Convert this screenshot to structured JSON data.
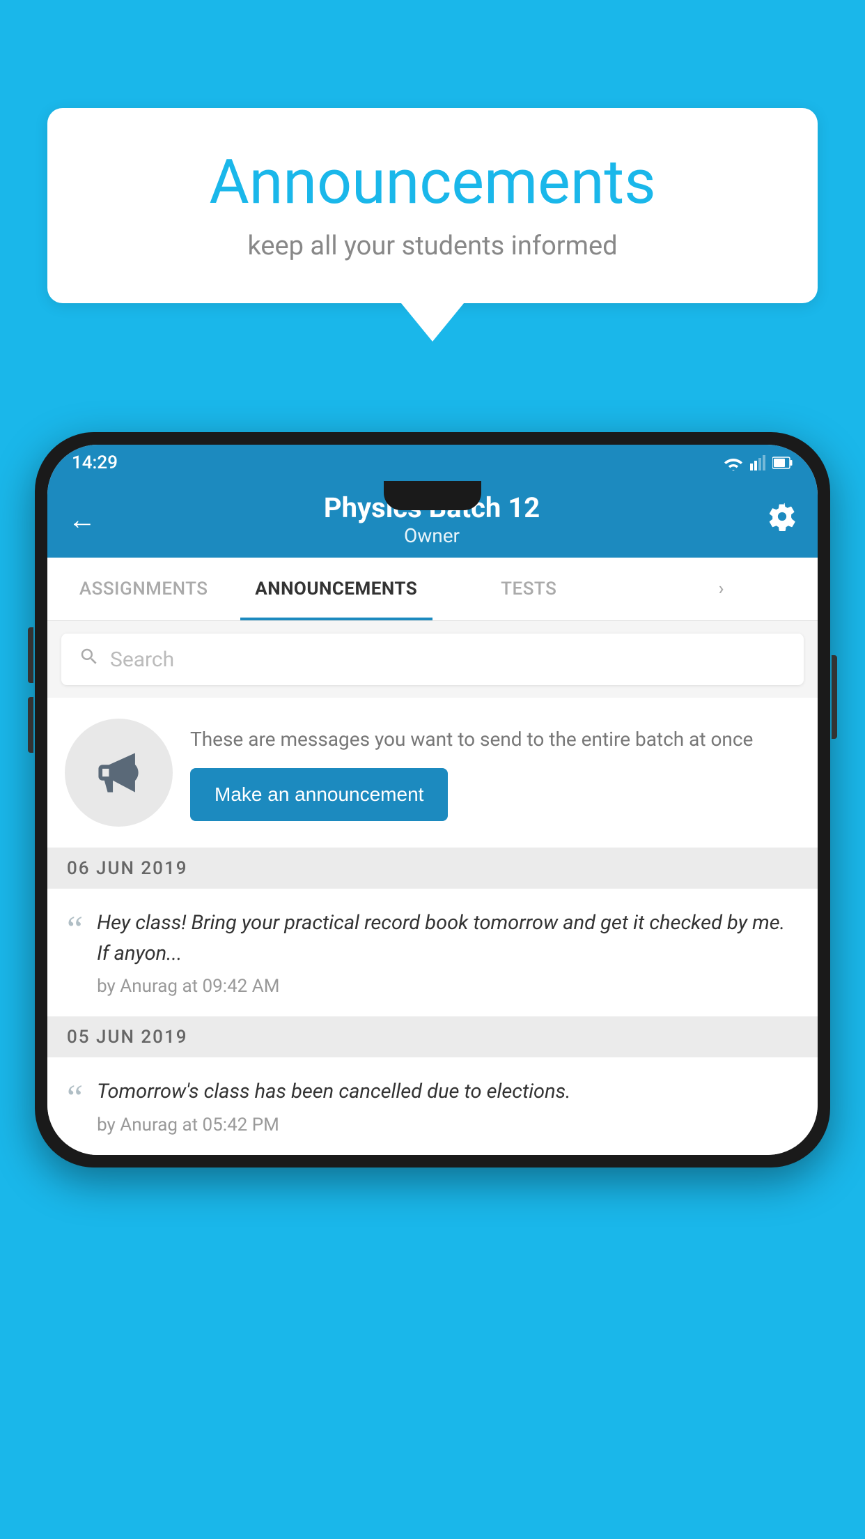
{
  "bubble": {
    "title": "Announcements",
    "subtitle": "keep all your students informed"
  },
  "phone": {
    "status_time": "14:29",
    "app_bar": {
      "title": "Physics Batch 12",
      "subtitle": "Owner"
    },
    "tabs": [
      {
        "label": "ASSIGNMENTS",
        "active": false
      },
      {
        "label": "ANNOUNCEMENTS",
        "active": true
      },
      {
        "label": "TESTS",
        "active": false
      },
      {
        "label": "",
        "active": false
      }
    ],
    "search": {
      "placeholder": "Search"
    },
    "intro": {
      "description": "These are messages you want to send to the entire batch at once",
      "button_label": "Make an announcement"
    },
    "announcements": [
      {
        "date": "06  JUN  2019",
        "text": "Hey class! Bring your practical record book tomorrow and get it checked by me. If anyon...",
        "meta": "by Anurag at 09:42 AM"
      },
      {
        "date": "05  JUN  2019",
        "text": "Tomorrow's class has been cancelled due to elections.",
        "meta": "by Anurag at 05:42 PM"
      }
    ]
  }
}
